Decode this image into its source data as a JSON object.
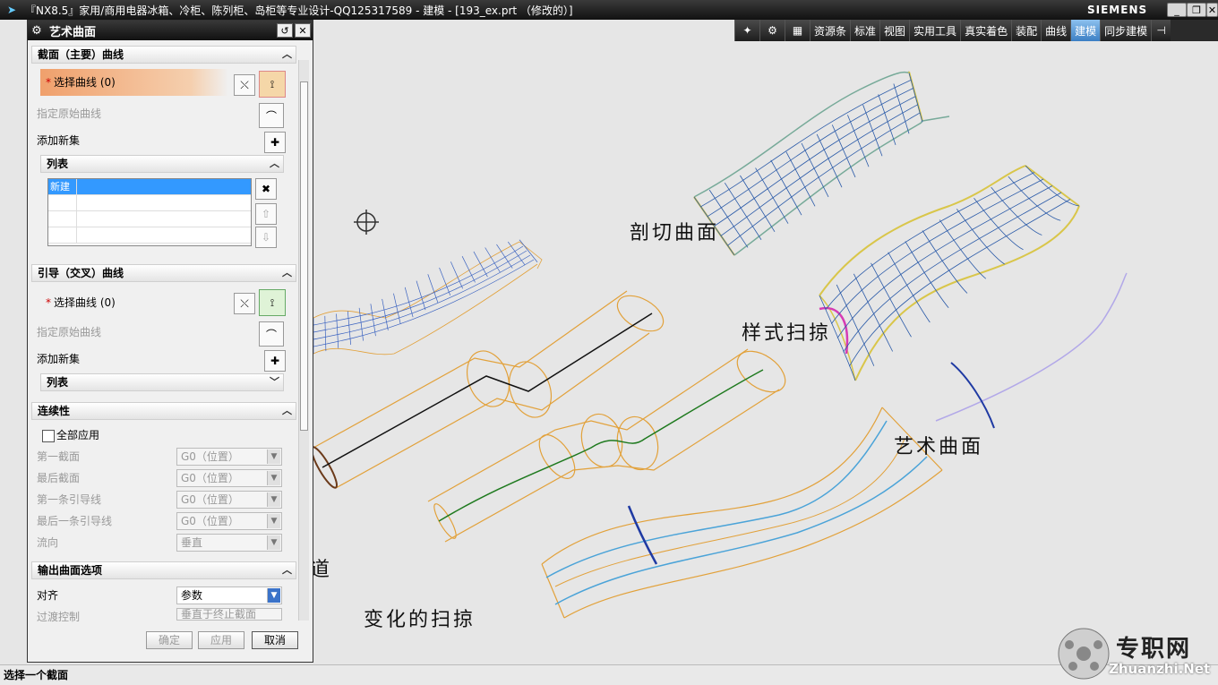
{
  "window": {
    "title": "『NX8.5』家用/商用电器冰箱、冷柜、陈列柜、岛柜等专业设计-QQ125317589 - 建模 - [193_ex.prt （修改的）]",
    "brand": "SIEMENS",
    "min": "_",
    "restore": "❐",
    "close": "✕"
  },
  "toolbar": {
    "tabs": [
      "资源条",
      "标准",
      "视图",
      "实用工具",
      "真实着色",
      "装配",
      "曲线",
      "建模",
      "同步建模"
    ],
    "active_tab": "建模"
  },
  "dialog": {
    "title": "艺术曲面",
    "section_primary": {
      "header": "截面（主要）曲线",
      "select_label": "选择曲线 (0)",
      "specify_origin": "指定原始曲线",
      "add_new_set": "添加新集",
      "list_header": "列表",
      "list_items": [
        "新建"
      ]
    },
    "section_guide": {
      "header": "引导（交叉）曲线",
      "select_label": "选择曲线 (0)",
      "specify_origin": "指定原始曲线",
      "add_new_set": "添加新集",
      "list_header": "列表"
    },
    "continuity": {
      "header": "连续性",
      "apply_all": "全部应用",
      "rows": [
        {
          "label": "第一截面",
          "value": "G0（位置）"
        },
        {
          "label": "最后截面",
          "value": "G0（位置）"
        },
        {
          "label": "第一条引导线",
          "value": "G0（位置）"
        },
        {
          "label": "最后一条引导线",
          "value": "G0（位置）"
        },
        {
          "label": "流向",
          "value": "垂直"
        }
      ]
    },
    "output": {
      "header": "输出曲面选项",
      "align_label": "对齐",
      "align_value": "参数",
      "transition_label": "过渡控制",
      "transition_value": "垂直于终止截面"
    },
    "buttons": {
      "ok": "确定",
      "apply": "应用",
      "cancel": "取消"
    }
  },
  "canvas": {
    "labels": {
      "section_surface": "剖切曲面",
      "styled_sweep": "样式扫掠",
      "studio_surface": "艺术曲面",
      "variational_sweep": "变化的扫掠",
      "partial": "道"
    }
  },
  "status": {
    "prompt": "选择一个截面"
  },
  "watermark": {
    "cn": "专职网",
    "en": "Zhuanzhi.Net"
  }
}
